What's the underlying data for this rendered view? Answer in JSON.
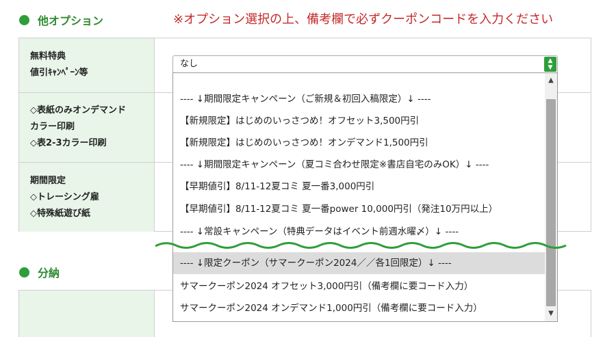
{
  "sections": [
    {
      "title": "他オプション"
    },
    {
      "title": "分納"
    }
  ],
  "notice": "※オプション選択の上、備考欄で必ずクーポンコードを入力ください",
  "rows": [
    {
      "lines": [
        "無料特典",
        "値引ｷｬﾝﾍﾟｰﾝ等"
      ]
    },
    {
      "lines": [
        "◇表紙のみオンデマンド",
        "カラー印刷",
        "◇表2-3カラー印刷"
      ]
    },
    {
      "lines": [
        "期間限定",
        "◇トレーシング雇",
        "◇特殊紙遊び紙"
      ]
    }
  ],
  "select": {
    "value": "なし"
  },
  "options": [
    "---- ↓期間限定キャンペーン（ご新規＆初回入稿限定）↓ ----",
    "【新規限定】はじめのいっさつめ！オフセット3,500円引",
    "【新規限定】はじめのいっさつめ！オンデマンド1,500円引",
    "---- ↓期間限定キャンペーン（夏コミ合わせ限定※書店自宅のみOK）↓ ----",
    "【早期値引】8/11-12夏コミ 夏一番3,000円引",
    "【早期値引】8/11-12夏コミ 夏一番power 10,000円引（発注10万円以上）",
    "---- ↓常設キャンペーン（特典データはイベント前週水曜〆）↓ ----",
    "---- ↓限定クーポン（サマークーポン2024／／各1回限定）↓ ----",
    "サマークーポン2024 オフセット3,000円引（備考欄に要コード入力）",
    "サマークーポン2024 オンデマンド1,000円引（備考欄に要コード入力）"
  ],
  "colors": {
    "accent": "#2e9e3a",
    "notice": "#c62828",
    "label_bg": "#e9f5e9",
    "highlight": "#dcdcdc"
  },
  "icons": {
    "select_arrow": "chevron-up-down-icon",
    "wave": "wave-divider"
  }
}
